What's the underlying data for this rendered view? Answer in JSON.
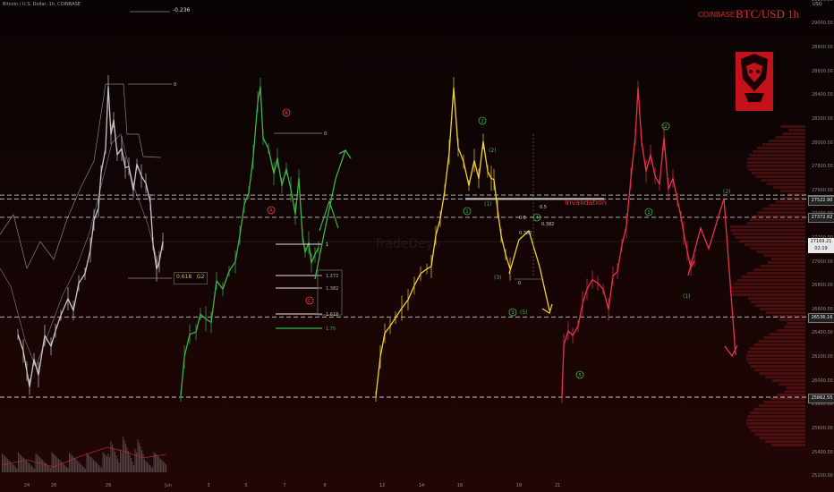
{
  "header": {
    "title": "Bitcoin / U.S. Dollar, 1h, COINBASE",
    "exchange": "COINBASE",
    "symbol": "BTC/USD 1h",
    "currency": "USD"
  },
  "watermark": "TradeDeyo",
  "annotations": {
    "invalidation": "Invalidation",
    "g2_level": "0.618",
    "g2_tag": "G2",
    "fib_top": "-0.236"
  },
  "colors": {
    "brand": "#e02a2a",
    "green": "#3bb54a",
    "yellow": "#f2d22e",
    "red": "#e8334a",
    "grey": "#c8c8c8",
    "bands": "#cfcfcf"
  },
  "chart_data": {
    "type": "line",
    "title": "BTC/USD 1h",
    "xlabel": "",
    "ylabel": "",
    "ylim": [
      25200,
      29600
    ],
    "y_axis_ticks": [
      25200,
      25400,
      25600,
      25800,
      26000,
      26200,
      26400,
      26600,
      26800,
      27000,
      27200,
      27400,
      27600,
      27800,
      28000,
      28200,
      28400,
      28600,
      28800,
      29000,
      29200,
      29400
    ],
    "x_axis_ticks": [
      "24",
      "26",
      "29",
      "Jun",
      "3",
      "5",
      "7",
      "9",
      "12",
      "14",
      "16",
      "19",
      "21"
    ],
    "price_labels": [
      {
        "value": "27527.47",
        "style": "dark"
      },
      {
        "value": "27522.90",
        "style": "dark"
      },
      {
        "value": "27372.82",
        "style": "dark"
      },
      {
        "value": "27169.21",
        "style": "current",
        "sub": "02:19"
      },
      {
        "value": "26536.16",
        "style": "dark"
      },
      {
        "value": "25862.55",
        "style": "dark"
      }
    ],
    "horizontal_levels": [
      27560,
      27527.47,
      27372.82,
      26536.16,
      25862.55
    ],
    "series": [
      {
        "color": "grey",
        "points": [
          [
            20,
            26390
          ],
          [
            26,
            26250
          ],
          [
            30,
            26080
          ],
          [
            33,
            25950
          ],
          [
            38,
            26180
          ],
          [
            43,
            26050
          ],
          [
            50,
            26380
          ],
          [
            57,
            26290
          ],
          [
            62,
            26420
          ],
          [
            68,
            26550
          ],
          [
            76,
            26690
          ],
          [
            82,
            26590
          ],
          [
            88,
            26820
          ],
          [
            95,
            26900
          ],
          [
            101,
            27100
          ],
          [
            105,
            27350
          ],
          [
            110,
            27450
          ],
          [
            113,
            27750
          ],
          [
            118,
            27950
          ],
          [
            121,
            28470
          ],
          [
            124,
            28070
          ],
          [
            127,
            28190
          ],
          [
            131,
            27900
          ],
          [
            136,
            27950
          ],
          [
            140,
            27790
          ],
          [
            144,
            27800
          ],
          [
            149,
            27600
          ],
          [
            153,
            27820
          ],
          [
            158,
            27720
          ],
          [
            163,
            27660
          ],
          [
            168,
            27500
          ],
          [
            171,
            27150
          ],
          [
            175,
            26940
          ],
          [
            178,
            27000
          ],
          [
            182,
            27170
          ]
        ]
      },
      {
        "color": "green",
        "points": [
          [
            202,
            25870
          ],
          [
            206,
            26200
          ],
          [
            212,
            26390
          ],
          [
            219,
            26410
          ],
          [
            224,
            26560
          ],
          [
            230,
            26520
          ],
          [
            236,
            26490
          ],
          [
            242,
            26840
          ],
          [
            249,
            26770
          ],
          [
            256,
            26920
          ],
          [
            263,
            27000
          ],
          [
            268,
            27220
          ],
          [
            273,
            27480
          ],
          [
            278,
            27580
          ],
          [
            283,
            27880
          ],
          [
            288,
            28340
          ],
          [
            291,
            28470
          ],
          [
            294,
            28040
          ],
          [
            300,
            27950
          ],
          [
            306,
            27740
          ],
          [
            310,
            27870
          ],
          [
            315,
            27640
          ],
          [
            320,
            27780
          ],
          [
            325,
            27610
          ],
          [
            330,
            27400
          ],
          [
            334,
            27700
          ],
          [
            338,
            27220
          ],
          [
            341,
            27080
          ],
          [
            345,
            27160
          ],
          [
            348,
            26990
          ],
          [
            352,
            27060
          ],
          [
            356,
            27120
          ]
        ]
      },
      {
        "color": "yellow",
        "points": [
          [
            420,
            25870
          ],
          [
            425,
            26200
          ],
          [
            430,
            26400
          ],
          [
            436,
            26460
          ],
          [
            442,
            26530
          ],
          [
            449,
            26610
          ],
          [
            456,
            26680
          ],
          [
            463,
            26800
          ],
          [
            470,
            26900
          ],
          [
            477,
            26940
          ],
          [
            482,
            26960
          ],
          [
            487,
            27220
          ],
          [
            492,
            27360
          ],
          [
            497,
            27600
          ],
          [
            502,
            27920
          ],
          [
            507,
            28460
          ],
          [
            512,
            27960
          ],
          [
            518,
            27840
          ],
          [
            524,
            27640
          ],
          [
            530,
            27850
          ],
          [
            535,
            27700
          ],
          [
            540,
            28010
          ],
          [
            545,
            27760
          ],
          [
            549,
            27700
          ],
          [
            552,
            27690
          ],
          [
            556,
            27440
          ],
          [
            560,
            27220
          ],
          [
            565,
            27060
          ],
          [
            570,
            26940
          ]
        ]
      },
      {
        "color": "red",
        "points": [
          [
            628,
            25860
          ],
          [
            630,
            26300
          ],
          [
            635,
            26420
          ],
          [
            640,
            26380
          ],
          [
            646,
            26460
          ],
          [
            651,
            26650
          ],
          [
            656,
            26770
          ],
          [
            662,
            26850
          ],
          [
            668,
            26820
          ],
          [
            674,
            26770
          ],
          [
            680,
            26600
          ],
          [
            685,
            26880
          ],
          [
            690,
            26920
          ],
          [
            695,
            27140
          ],
          [
            700,
            27300
          ],
          [
            705,
            27700
          ],
          [
            710,
            28050
          ],
          [
            713,
            28460
          ],
          [
            717,
            28010
          ],
          [
            722,
            27760
          ],
          [
            727,
            27900
          ],
          [
            732,
            27720
          ],
          [
            737,
            27650
          ],
          [
            742,
            28040
          ],
          [
            747,
            27610
          ],
          [
            752,
            27700
          ],
          [
            757,
            27520
          ],
          [
            761,
            27380
          ],
          [
            764,
            27240
          ],
          [
            768,
            27090
          ],
          [
            772,
            26950
          ],
          [
            776,
            27010
          ]
        ]
      }
    ],
    "green_labels": [
      "A",
      "B",
      "C",
      "1",
      "1.272",
      "1.382",
      "1.618",
      "1.75",
      "0"
    ],
    "yellow_labels": [
      "1",
      "2",
      "(1)",
      "(2)",
      "(3)",
      "3",
      "(5)",
      "4",
      "0.5",
      "0.382",
      "0.5",
      "0.382",
      "0"
    ],
    "red_labels": [
      "1",
      "2",
      "5",
      "(1)",
      "(2)"
    ]
  }
}
